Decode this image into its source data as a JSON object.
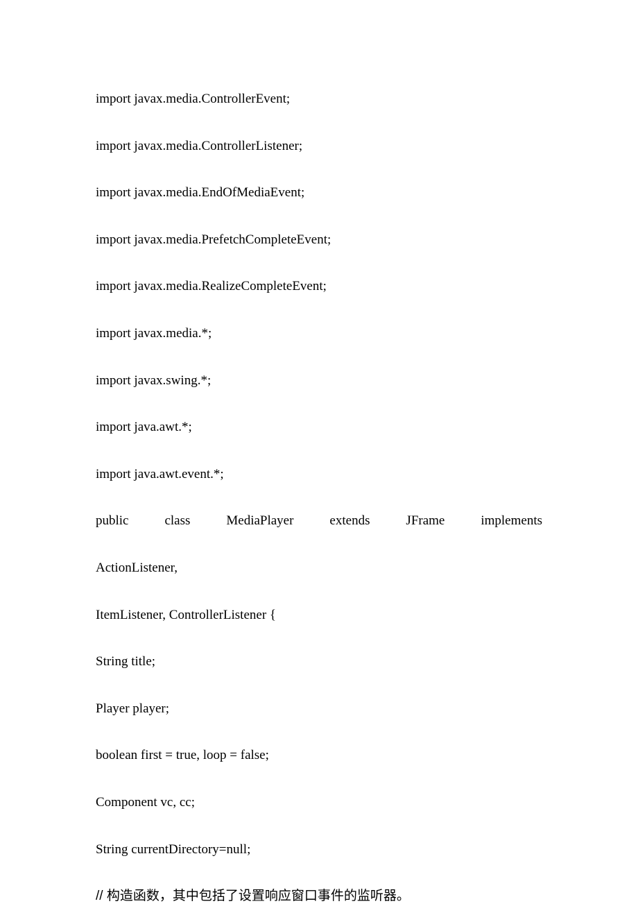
{
  "lines": {
    "l1": "import javax.media.ControllerEvent;",
    "l2": "import javax.media.ControllerListener;",
    "l3": "import javax.media.EndOfMediaEvent;",
    "l4": "import javax.media.PrefetchCompleteEvent;",
    "l5": "import javax.media.RealizeCompleteEvent;",
    "l6": "import javax.media.*;",
    "l7": "import javax.swing.*;",
    "l8": "import java.awt.*;",
    "l9": "import java.awt.event.*;",
    "l10": "public class MediaPlayer extends JFrame implements",
    "l11": "ActionListener,",
    "l12": "ItemListener, ControllerListener {",
    "l13": "String title;",
    "l14": "Player player;",
    "l15": "boolean first = true, loop = false;",
    "l16": "Component vc, cc;",
    "l17": "String currentDirectory=null;",
    "l18": "// 构造函数，其中包括了设置响应窗口事件的监听器。"
  }
}
